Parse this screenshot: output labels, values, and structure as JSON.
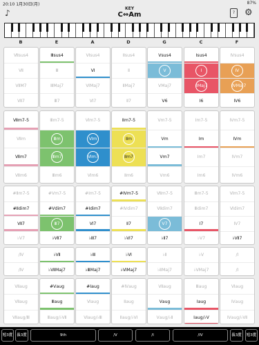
{
  "status": {
    "time": "20:10",
    "date": "1月30日(月)",
    "battery": "87%"
  },
  "header": {
    "key_label": "KEY",
    "key_value": "C⇔Am",
    "settings_icon": "gear-icon",
    "guitar_icon": "guitar-icon",
    "help_icon": "book-icon"
  },
  "columns": [
    "B",
    "E",
    "A",
    "D",
    "G",
    "C",
    "F"
  ],
  "colors": {
    "green": "#7dc26e",
    "blue": "#2f8fcc",
    "light_blue": "#7bbcd8",
    "yellow": "#ede055",
    "red": "#e85566",
    "orange": "#e8a055",
    "pink": "#e5a0b4",
    "gray_text": "#b2b2b2"
  },
  "groups": [
    {
      "name": "diatonic-major",
      "cells": [
        [
          {
            "t": "Ⅶsus4",
            "s": "dim"
          },
          {
            "t": "Ⅶ",
            "s": "dim"
          },
          {
            "t": "ⅦM7",
            "s": "dim"
          },
          {
            "t": "Ⅶ7",
            "s": "dim"
          }
        ],
        [
          {
            "t": "Ⅲsus4",
            "s": "act",
            "strip": "green"
          },
          {
            "t": "Ⅲ",
            "s": "dim"
          },
          {
            "t": "ⅢMaj7",
            "s": "dim"
          },
          {
            "t": "Ⅲ7",
            "s": "dim"
          }
        ],
        [
          {
            "t": "Ⅵsus4",
            "s": "dim"
          },
          {
            "t": "Ⅵ",
            "s": "act",
            "strip": "blue"
          },
          {
            "t": "ⅥMaj7",
            "s": "dim"
          },
          {
            "t": "Ⅵ7",
            "s": "dim"
          }
        ],
        [
          {
            "t": "Ⅱsus4",
            "s": "dim"
          },
          {
            "t": "Ⅱ",
            "s": "dim"
          },
          {
            "t": "ⅡMaj7",
            "s": "dim"
          },
          {
            "t": "Ⅱ7",
            "s": "dim"
          }
        ],
        [
          {
            "t": "Vsus4",
            "s": "act",
            "strip": "light_blue"
          },
          {
            "t": "V",
            "s": "circ",
            "fill": "light_blue"
          },
          {
            "t": "VMaj7",
            "s": "dim"
          },
          {
            "t": "V6",
            "s": "act",
            "strip": "light_blue"
          }
        ],
        [
          {
            "t": "Ⅰsus4",
            "s": "act",
            "strip": "red"
          },
          {
            "t": "Ⅰ",
            "s": "circ",
            "fill": "red"
          },
          {
            "t": "ⅠMaj7",
            "s": "circ",
            "fill": "red"
          },
          {
            "t": "Ⅰ6",
            "s": "act",
            "strip": "red"
          }
        ],
        [
          {
            "t": "Ⅳsus4",
            "s": "dim"
          },
          {
            "t": "Ⅳ",
            "s": "circ",
            "fill": "orange"
          },
          {
            "t": "ⅣMaj7",
            "s": "circ",
            "fill": "orange"
          },
          {
            "t": "Ⅳ6",
            "s": "act",
            "strip": "orange"
          }
        ]
      ]
    },
    {
      "name": "minor",
      "cells": [
        [
          {
            "t": "Ⅶm7-5",
            "s": "act",
            "strip": "pink"
          },
          {
            "t": "Ⅶm",
            "s": "dim"
          },
          {
            "t": "Ⅶm7",
            "s": "act",
            "strip": "pink"
          },
          {
            "t": "Ⅶm6",
            "s": "dim"
          }
        ],
        [
          {
            "t": "Ⅲm7-5",
            "s": "dim"
          },
          {
            "t": "Ⅲm",
            "s": "circ",
            "fill": "green"
          },
          {
            "t": "Ⅲm7",
            "s": "circ",
            "fill": "green"
          },
          {
            "t": "Ⅲm6",
            "s": "dim"
          }
        ],
        [
          {
            "t": "Ⅵm7-5",
            "s": "dim"
          },
          {
            "t": "Ⅵm",
            "s": "circ",
            "fill": "blue"
          },
          {
            "t": "Ⅵm7",
            "s": "circ",
            "fill": "blue"
          },
          {
            "t": "Ⅵm6",
            "s": "dim"
          }
        ],
        [
          {
            "t": "Ⅱm7-5",
            "s": "act",
            "strip": "yellow"
          },
          {
            "t": "Ⅱm",
            "s": "circ",
            "fill": "yellow"
          },
          {
            "t": "Ⅱm7",
            "s": "circ",
            "fill": "yellow"
          },
          {
            "t": "Ⅱm6",
            "s": "dim"
          }
        ],
        [
          {
            "t": "Vm7-5",
            "s": "dim"
          },
          {
            "t": "Vm",
            "s": "act",
            "strip": "light_blue"
          },
          {
            "t": "Vm7",
            "s": "act",
            "strip": "light_blue"
          },
          {
            "t": "Vm6",
            "s": "dim"
          }
        ],
        [
          {
            "t": "Ⅰm7-5",
            "s": "dim"
          },
          {
            "t": "Ⅰm",
            "s": "act",
            "strip": "red"
          },
          {
            "t": "Ⅰm7",
            "s": "dim"
          },
          {
            "t": "Ⅰm6",
            "s": "dim"
          }
        ],
        [
          {
            "t": "Ⅳm7-5",
            "s": "dim"
          },
          {
            "t": "Ⅳm",
            "s": "act",
            "strip": "orange"
          },
          {
            "t": "Ⅳm7",
            "s": "dim"
          },
          {
            "t": "Ⅳm6",
            "s": "dim"
          }
        ]
      ]
    },
    {
      "name": "secondary",
      "cells": [
        [
          {
            "t": "#Ⅱm7-5",
            "s": "dim"
          },
          {
            "t": "#Ⅱdim7",
            "s": "act",
            "strip": "pink"
          },
          {
            "t": "Ⅶ7",
            "s": "act",
            "strip": "pink"
          },
          {
            "t": "♭Ⅴ7",
            "s": "dim"
          }
        ],
        [
          {
            "t": "#Ⅴm7-5",
            "s": "dim"
          },
          {
            "t": "#Ⅴdim7",
            "s": "act",
            "strip": "green"
          },
          {
            "t": "Ⅲ7",
            "s": "circ",
            "fill": "green"
          },
          {
            "t": "♭Ⅶ7",
            "s": "act",
            "strip": "green"
          }
        ],
        [
          {
            "t": "#Ⅰm7-5",
            "s": "dim"
          },
          {
            "t": "#Ⅰdim7",
            "s": "act",
            "strip": "blue"
          },
          {
            "t": "Ⅵ7",
            "s": "act",
            "strip": "blue"
          },
          {
            "t": "♭Ⅲ7",
            "s": "act",
            "strip": "blue"
          }
        ],
        [
          {
            "t": "#Ⅳm7-5",
            "s": "act",
            "strip": "yellow"
          },
          {
            "t": "#Ⅳdim7",
            "s": "dim"
          },
          {
            "t": "Ⅱ7",
            "s": "act",
            "strip": "yellow"
          },
          {
            "t": "♭Ⅵ7",
            "s": "act",
            "strip": "yellow"
          }
        ],
        [
          {
            "t": "Ⅶm7-5",
            "s": "dim"
          },
          {
            "t": "Ⅶdim7",
            "s": "dim"
          },
          {
            "t": "Ⅴ7",
            "s": "circ",
            "fill": "light_blue"
          },
          {
            "t": "♭Ⅱ7",
            "s": "act",
            "strip": "light_blue"
          }
        ],
        [
          {
            "t": "Ⅲm7-5",
            "s": "dim"
          },
          {
            "t": "Ⅲdim7",
            "s": "dim"
          },
          {
            "t": "Ⅰ7",
            "s": "act",
            "strip": "red"
          },
          {
            "t": "♭Ⅴ7",
            "s": "dim"
          }
        ],
        [
          {
            "t": "Ⅵm7-5",
            "s": "dim"
          },
          {
            "t": "Ⅵdim7",
            "s": "dim"
          },
          {
            "t": "Ⅳ7",
            "s": "dim"
          },
          {
            "t": "♭Ⅶ7",
            "s": "act",
            "strip": "orange"
          }
        ]
      ]
    },
    {
      "name": "borrowed",
      "cells": [
        [
          {
            "t": "/Ⅳ",
            "s": "dim"
          },
          {
            "t": "/Ⅳ",
            "s": "dim"
          }
        ],
        [
          {
            "t": "♭Ⅶ",
            "s": "act",
            "strip": "green"
          },
          {
            "t": "♭ⅦMaj7",
            "s": "act",
            "strip": "green"
          }
        ],
        [
          {
            "t": "♭Ⅲ",
            "s": "act",
            "strip": "blue"
          },
          {
            "t": "♭ⅢMaj7",
            "s": "act",
            "strip": "blue"
          }
        ],
        [
          {
            "t": "♭Ⅵ",
            "s": "act",
            "strip": "yellow"
          },
          {
            "t": "♭ⅥMaj7",
            "s": "act",
            "strip": "yellow"
          }
        ],
        [
          {
            "t": "♭Ⅱ",
            "s": "dim"
          },
          {
            "t": "♭ⅡMaj7",
            "s": "dim"
          }
        ],
        [
          {
            "t": "♭Ⅴ",
            "s": "dim"
          },
          {
            "t": "♭ⅤMaj7",
            "s": "dim"
          }
        ],
        [
          {
            "t": "/Ⅰ",
            "s": "dim"
          },
          {
            "t": "/Ⅰ",
            "s": "dim"
          }
        ]
      ]
    },
    {
      "name": "augmented",
      "cells": [
        [
          {
            "t": "Ⅶaug",
            "s": "dim"
          },
          {
            "t": "Ⅶaug",
            "s": "dim"
          },
          {
            "t": "Ⅶaug/Ⅲ",
            "s": "dim"
          }
        ],
        [
          {
            "t": "#Ⅴaug",
            "s": "act",
            "strip": "green"
          },
          {
            "t": "Ⅲaug",
            "s": "act",
            "strip": "green"
          },
          {
            "t": "Ⅲaug/♭Ⅶ",
            "s": "dim"
          }
        ],
        [
          {
            "t": "#Ⅰaug",
            "s": "act",
            "strip": "blue"
          },
          {
            "t": "Ⅵaug",
            "s": "dim"
          },
          {
            "t": "Ⅵaug/♭Ⅲ",
            "s": "dim"
          }
        ],
        [
          {
            "t": "#Ⅳaug",
            "s": "dim"
          },
          {
            "t": "Ⅱaug",
            "s": "dim"
          },
          {
            "t": "Ⅱaug/♭Ⅵ",
            "s": "dim"
          }
        ],
        [
          {
            "t": "Ⅶaug",
            "s": "dim"
          },
          {
            "t": "Ⅴaug",
            "s": "act",
            "strip": "light_blue"
          },
          {
            "t": "Ⅴaug/♭Ⅱ",
            "s": "dim"
          }
        ],
        [
          {
            "t": "Ⅲaug",
            "s": "dim"
          },
          {
            "t": "Ⅰaug",
            "s": "act",
            "strip": "red"
          },
          {
            "t": "Ⅰaug/♭Ⅴ",
            "s": "act",
            "strip": "red"
          }
        ],
        [
          {
            "t": "Ⅵaug",
            "s": "dim"
          },
          {
            "t": "Ⅳaug",
            "s": "dim"
          },
          {
            "t": "Ⅳaug/♭Ⅶ",
            "s": "dim"
          }
        ]
      ]
    }
  ],
  "bottom": [
    {
      "label": "短3度"
    },
    {
      "label": "長3度"
    },
    {
      "label": "9th"
    },
    {
      "label": "/V"
    },
    {
      "label": "/I"
    },
    {
      "label": "/IV"
    },
    {
      "label": "長3度"
    },
    {
      "label": "短3度"
    }
  ]
}
